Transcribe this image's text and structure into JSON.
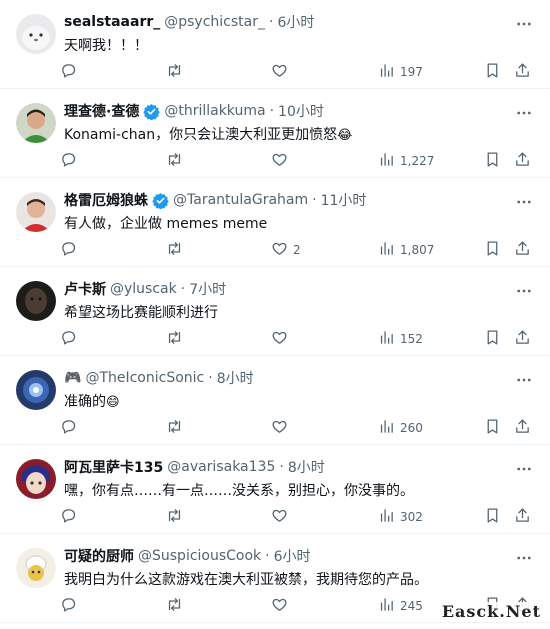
{
  "colors": {
    "text": "#0f1419",
    "secondary": "#536471",
    "verified": "#1d9bf0",
    "border": "#eff3f4"
  },
  "tweets": [
    {
      "name": "sealstaaarr_",
      "verified": false,
      "handle": "@psychicstar_",
      "time": "6小时",
      "text": "天啊我！！！",
      "replies": "",
      "retweets": "",
      "likes": "",
      "views": "197",
      "avatar": "seal"
    },
    {
      "name": "理查德·查德",
      "verified": true,
      "handle": "@thrillakkuma",
      "time": "10小时",
      "text": "Konami-chan，你只会让澳大利亚更加愤怒",
      "emoji": "😂",
      "replies": "",
      "retweets": "",
      "likes": "",
      "views": "1,227",
      "avatar": "man-green"
    },
    {
      "name": "格雷厄姆狼蛛",
      "verified": true,
      "handle": "@TarantulaGraham",
      "time": "11小时",
      "text": "有人做，企业做 memes meme",
      "replies": "",
      "retweets": "",
      "likes": "2",
      "views": "1,807",
      "avatar": "man-red"
    },
    {
      "name": "卢卡斯",
      "verified": false,
      "handle": "@yluscak",
      "time": "7小时",
      "text": "希望这场比赛能顺利进行",
      "replies": "",
      "retweets": "",
      "likes": "",
      "views": "152",
      "avatar": "dark"
    },
    {
      "name": "🎮",
      "verified": false,
      "handle": "@TheIconicSonic",
      "time": "8小时",
      "text": "准确的",
      "emoji": "😄",
      "replies": "",
      "retweets": "",
      "likes": "",
      "views": "260",
      "avatar": "sonic"
    },
    {
      "name": "阿瓦里萨卡135",
      "verified": false,
      "handle": "@avarisaka135",
      "time": "8小时",
      "text": "嘿，你有点……有一点……没关系，别担心，你没事的。",
      "replies": "",
      "retweets": "",
      "likes": "",
      "views": "302",
      "avatar": "anime"
    },
    {
      "name": "可疑的厨师",
      "verified": false,
      "handle": "@SuspiciousCook",
      "time": "6小时",
      "text": "我明白为什么这款游戏在澳大利亚被禁，我期待您的产品。",
      "replies": "",
      "retweets": "",
      "likes": "",
      "views": "245",
      "avatar": "cook"
    }
  ],
  "watermark": "Easck.Net"
}
